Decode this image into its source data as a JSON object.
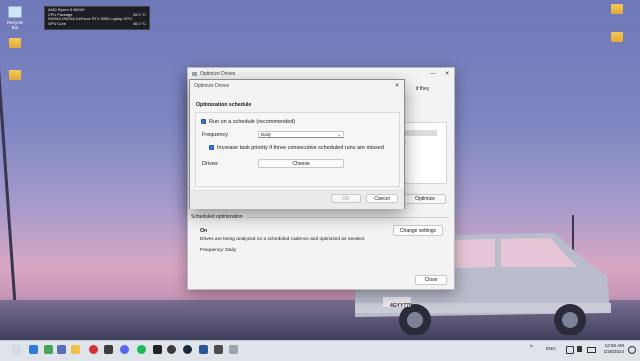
{
  "desktop": {
    "icons": [
      {
        "label": "Recycle Bin",
        "icon": "recycle-bin-icon"
      },
      {
        "label": "",
        "icon": "folder-icon"
      },
      {
        "label": "",
        "icon": "folder-icon"
      },
      {
        "label": "",
        "icon": "folder-icon"
      },
      {
        "label": "",
        "icon": "folder-icon"
      }
    ],
    "license_plate": "4GYY770"
  },
  "hwinfo": {
    "rows": [
      {
        "label": "AMD Ryzen 5 5600H",
        "value": ""
      },
      {
        "label": "CPU Package",
        "value": "49.0 °C"
      },
      {
        "label": "NVIDIA NVIDIA GeForce RTX 3050 Laptop GPU",
        "value": ""
      },
      {
        "label": "GPU Core",
        "value": "46.0 °C"
      }
    ]
  },
  "outer": {
    "title": "Optimize Drives",
    "right_text_fragment": "if they",
    "status_fragment_1": "0",
    "status_fragment_2": "0",
    "optimize_label": "Optimize",
    "scheduled_heading": "Scheduled optimization",
    "status_on": "On",
    "status_desc": "Drives are being analyzed on a scheduled cadence and optimized as needed.",
    "frequency_line": "Frequency: Daily",
    "change_settings_label": "Change settings",
    "close_label": "Close"
  },
  "dialog": {
    "title": "Optimize Drives",
    "heading": "Optimization schedule",
    "run_on_schedule": "Run on a schedule (recommended)",
    "frequency_label": "Frequency",
    "frequency_value": "Daily",
    "increase_priority": "Increase task priority if three consecutive scheduled runs are missed",
    "drives_label": "Drives",
    "choose_label": "Choose",
    "ok_label": "OK",
    "cancel_label": "Cancel"
  },
  "taskbar": {
    "lang": "ENG",
    "time": "12:56 AM",
    "date": "1/28/2024"
  },
  "colors": {
    "accent": "#1f5fbf"
  }
}
